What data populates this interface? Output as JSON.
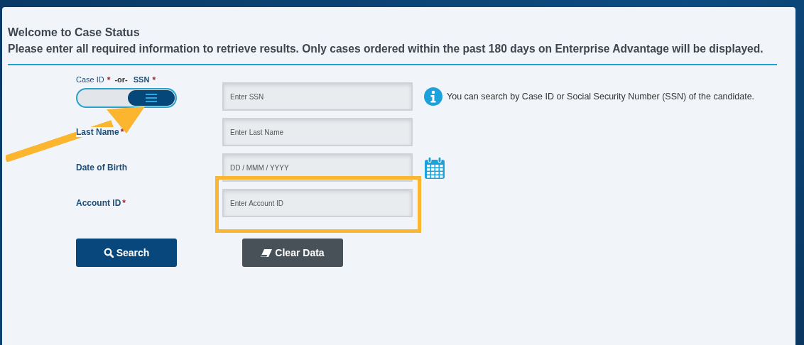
{
  "header": {
    "title": "Welcome to Case Status",
    "subtitle": "Please enter all required information to retrieve results. Only cases ordered within the past 180 days on Enterprise Advantage will be displayed."
  },
  "toggle": {
    "left_label": "Case ID",
    "left_mark": "*",
    "separator": "-or-",
    "right_label": "SSN",
    "right_mark": "*",
    "on": true
  },
  "fields": [
    {
      "placeholder": "Enter SSN",
      "kind": "text",
      "highlighted": false
    },
    {
      "label": "Last Name",
      "required_mark": "*",
      "placeholder": "Enter Last Name",
      "kind": "text",
      "highlighted": false
    },
    {
      "label": "Date of Birth",
      "placeholder": "DD / MMM / YYYY",
      "kind": "date",
      "highlighted": false
    },
    {
      "label": "Account ID",
      "required_mark": "*",
      "placeholder": "Enter Account ID",
      "kind": "text",
      "highlighted": true
    }
  ],
  "info_text": "You can search by Case ID or Social Security Number (SSN) of the candidate.",
  "buttons": [
    {
      "label": "Search",
      "kind": "search"
    },
    {
      "label": "Clear Data",
      "kind": "clear"
    }
  ]
}
